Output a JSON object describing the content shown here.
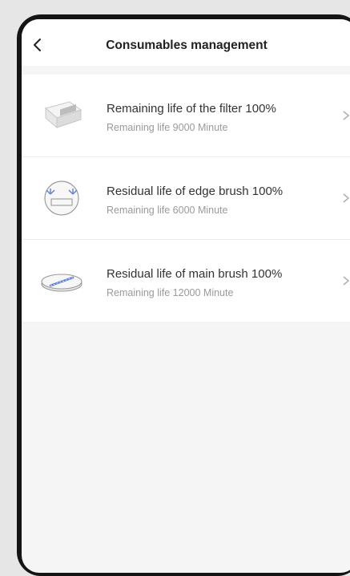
{
  "header": {
    "title": "Consumables management",
    "back_icon": "chevron-left-icon"
  },
  "consumables": [
    {
      "title": "Remaining life of the filter 100%",
      "subtitle": "Remaining life 9000 Minute",
      "icon": "filter-icon"
    },
    {
      "title": "Residual life of edge brush 100%",
      "subtitle": "Remaining life 6000 Minute",
      "icon": "edge-brush-icon"
    },
    {
      "title": "Residual life of main brush 100%",
      "subtitle": "Remaining life 12000 Minute",
      "icon": "main-brush-icon"
    }
  ],
  "colors": {
    "background": "#f5f5f5",
    "card": "#ffffff",
    "title_text": "#333333",
    "subtitle_text": "#9a9a9a",
    "icon_accent": "#5b7fd6"
  }
}
